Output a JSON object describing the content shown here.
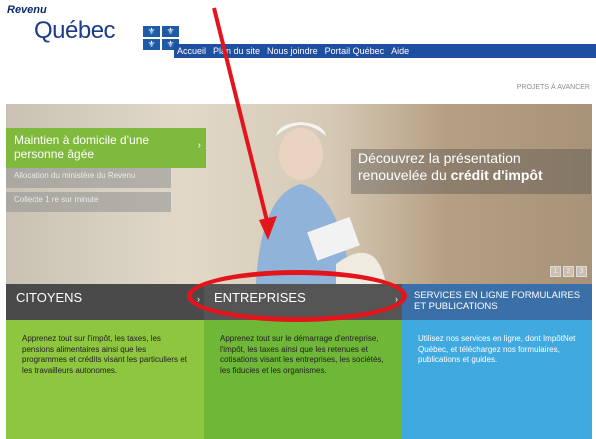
{
  "brand": {
    "small": "Revenu",
    "big": "Québec"
  },
  "nav": [
    "Accueil",
    "Plan du site",
    "Nous joindre",
    "Portail Québec",
    "Aide"
  ],
  "lang": "PROJETS À AVANCER",
  "hero": {
    "feature_title": "Maintien à domicile d'une personne âgée",
    "feature_items": [
      "Allocation du ministère du Revenu",
      "Collecte 1 re sur minute"
    ],
    "headline_a": "Découvrez la présentation",
    "headline_b": "renouvelée du",
    "headline_bold": "crédit d'impôt",
    "pager": [
      "1",
      "2",
      "3"
    ]
  },
  "tabs": {
    "citoyens": "CITOYENS",
    "entreprises": "ENTREPRISES",
    "services": "SERVICES EN LIGNE FORMULAIRES ET PUBLICATIONS"
  },
  "bodies": {
    "citoyens": "Apprenez tout sur l'impôt, les taxes, les pensions alimentaires ainsi que les programmes et crédits visant les particuliers et les travailleurs autonomes.",
    "entreprises": "Apprenez tout sur le démarrage d'entreprise, l'impôt, les taxes ainsi que les retenues et cotisations visant les entreprises, les sociétés, les fiducies et les organismes.",
    "services": "Utilisez nos services en ligne, dont ImpôtNet Québec, et téléchargez nos formulaires, publications et guides."
  },
  "colors": {
    "nav": "#1e4fa0",
    "green": "#8ec63f",
    "blue": "#3fa9e0",
    "annotation": "#e3141c"
  }
}
